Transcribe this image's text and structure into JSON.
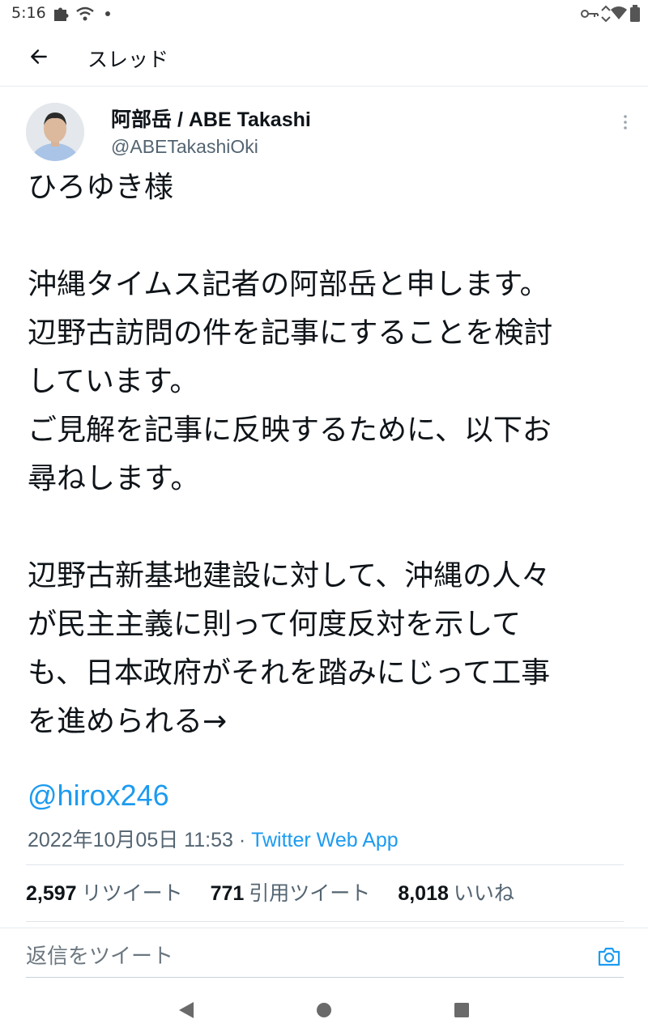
{
  "status_bar": {
    "time": "5:16",
    "icons": [
      "puzzle-icon",
      "wifi-icon",
      "dot-icon",
      "vpn-key-icon",
      "signal-icon",
      "wifi-full-icon",
      "battery-icon"
    ]
  },
  "header": {
    "title": "スレッド",
    "back_icon": "arrow-left-icon"
  },
  "tweet": {
    "author_name": "阿部岳 / ABE Takashi",
    "author_handle": "@ABETakashiOki",
    "paragraphs": [
      "ひろゆき様",
      "沖縄タイムス記者の阿部岳と申します。\n辺野古訪問の件を記事にすることを検討\nしています。\nご見解を記事に反映するために、以下お\n尋ねします。",
      "辺野古新基地建設に対して、沖縄の人々\nが民主主義に則って何度反対を示して\nも、日本政府がそれを踏みにじって工事\nを進められる→"
    ],
    "mention": "@hirox246",
    "timestamp": "2022年10月05日 11:53",
    "separator": " · ",
    "source": "Twitter Web App",
    "stats": {
      "retweets_count": "2,597",
      "retweets_label": "リツイート",
      "quotes_count": "771",
      "quotes_label": "引用ツイート",
      "likes_count": "8,018",
      "likes_label": "いいね"
    }
  },
  "reply": {
    "placeholder": "返信をツイート"
  },
  "colors": {
    "accent": "#1d9bf0",
    "text": "#0f1419",
    "secondary": "#536471"
  }
}
